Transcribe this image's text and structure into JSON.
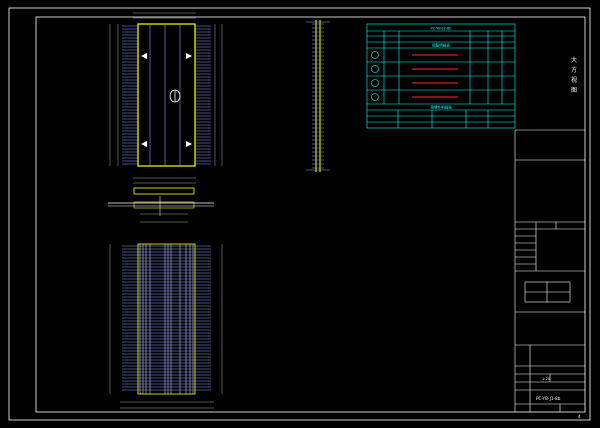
{
  "colors": {
    "background": "#000000",
    "frame": "#ffffff",
    "table": "#00ffff",
    "panel_border": "#ffff00",
    "rebar": "#8aa0ff",
    "dim": "#cfcfcf",
    "red": "#ff2a2a",
    "green": "#00ff66",
    "magenta": "#ff55ff"
  },
  "title_block": {
    "drawing_number": "PC-YB-J1-8b",
    "scale": "1:20"
  },
  "right_text": {
    "col1": "大",
    "col2": "方",
    "col3": "视",
    "col4": "图"
  },
  "table": {
    "header1": "PC-YB-J1-8b",
    "header2": "钢筋明细表",
    "header3": "预埋件明细表"
  },
  "labels": {
    "sheet_no": "4"
  },
  "icons": {
    "lifting_point": "lifting-ring-icon",
    "arrow": "triangle-arrow-icon"
  }
}
